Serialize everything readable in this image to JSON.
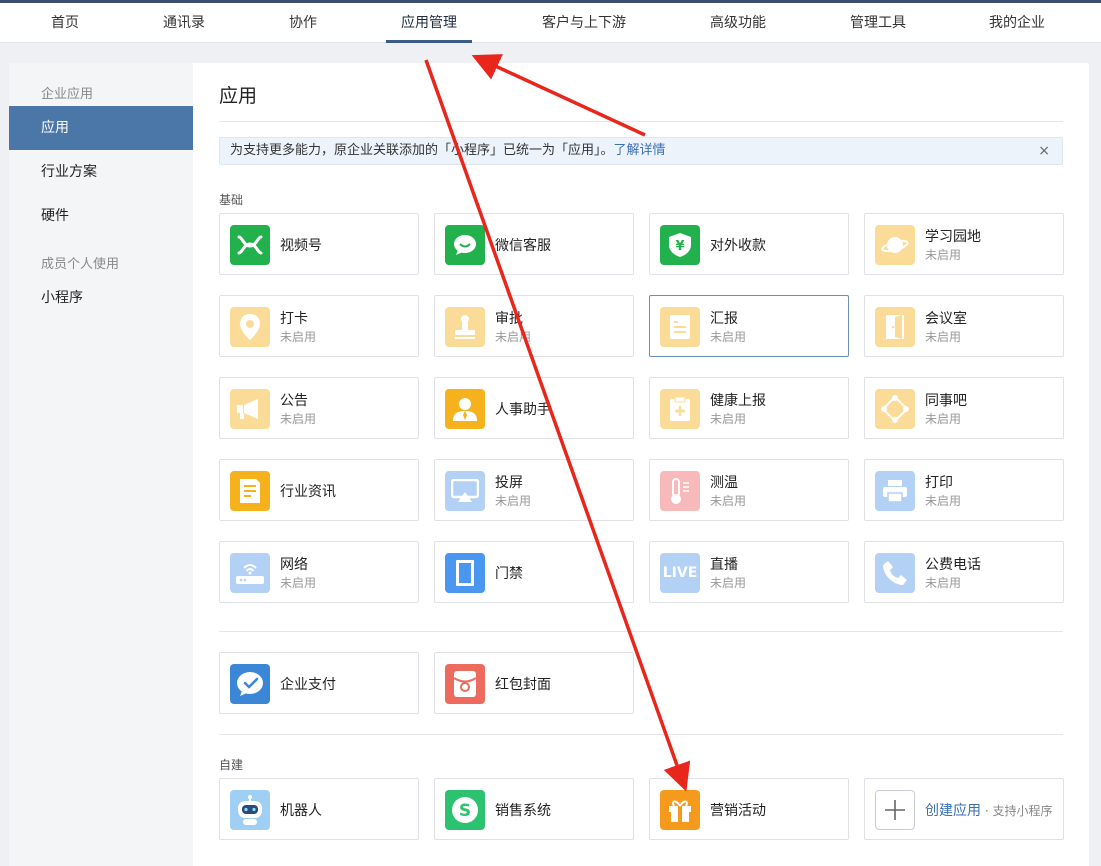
{
  "topnav": {
    "items": [
      {
        "label": "首页",
        "active": false
      },
      {
        "label": "通讯录",
        "active": false
      },
      {
        "label": "协作",
        "active": false
      },
      {
        "label": "应用管理",
        "active": true
      },
      {
        "label": "客户与上下游",
        "active": false
      },
      {
        "label": "高级功能",
        "active": false
      },
      {
        "label": "管理工具",
        "active": false
      },
      {
        "label": "我的企业",
        "active": false
      }
    ]
  },
  "sidebar": {
    "section1": "企业应用",
    "items1": [
      {
        "label": "应用",
        "active": true
      },
      {
        "label": "行业方案",
        "active": false
      },
      {
        "label": "硬件",
        "active": false
      }
    ],
    "section2": "成员个人使用",
    "items2": [
      {
        "label": "小程序",
        "active": false
      }
    ]
  },
  "main": {
    "title": "应用",
    "notice": {
      "text": "为支持更多能力，原企业关联添加的「小程序」已统一为「应用」。",
      "link": "了解详情",
      "close": "×"
    },
    "basic_label": "基础",
    "custom_label": "自建",
    "disabled_text": "未启用",
    "basic_apps": [
      {
        "name": "视频号",
        "enabled": true,
        "icon": "channels-icon",
        "color": "#22b14c"
      },
      {
        "name": "微信客服",
        "enabled": true,
        "icon": "chat-bubble-icon",
        "color": "#22b14c"
      },
      {
        "name": "对外收款",
        "enabled": true,
        "icon": "yuan-shield-icon",
        "color": "#22b14c"
      },
      {
        "name": "学习园地",
        "enabled": false,
        "icon": "planet-icon",
        "color": "#fbdb98"
      },
      {
        "name": "打卡",
        "enabled": false,
        "icon": "location-pin-icon",
        "color": "#fbdb98"
      },
      {
        "name": "审批",
        "enabled": false,
        "icon": "stamp-icon",
        "color": "#fbdb98"
      },
      {
        "name": "汇报",
        "enabled": false,
        "icon": "report-icon",
        "color": "#fbdb98"
      },
      {
        "name": "会议室",
        "enabled": false,
        "icon": "door-icon",
        "color": "#fbdb98"
      },
      {
        "name": "公告",
        "enabled": false,
        "icon": "megaphone-icon",
        "color": "#fbdb98"
      },
      {
        "name": "人事助手",
        "enabled": true,
        "icon": "person-icon",
        "color": "#f5b21d"
      },
      {
        "name": "健康上报",
        "enabled": false,
        "icon": "clipboard-plus-icon",
        "color": "#fbdb98"
      },
      {
        "name": "同事吧",
        "enabled": false,
        "icon": "network-icon",
        "color": "#fbdb98"
      },
      {
        "name": "行业资讯",
        "enabled": true,
        "icon": "news-icon",
        "color": "#f5b21d"
      },
      {
        "name": "投屏",
        "enabled": false,
        "icon": "screen-cast-icon",
        "color": "#b3d0f5"
      },
      {
        "name": "测温",
        "enabled": false,
        "icon": "thermometer-icon",
        "color": "#f7b9b9"
      },
      {
        "name": "打印",
        "enabled": false,
        "icon": "printer-icon",
        "color": "#b3d0f5"
      },
      {
        "name": "网络",
        "enabled": false,
        "icon": "router-icon",
        "color": "#b3d0f5"
      },
      {
        "name": "门禁",
        "enabled": true,
        "icon": "gate-icon",
        "color": "#4a96f0"
      },
      {
        "name": "直播",
        "enabled": false,
        "icon": "live-icon",
        "color": "#b3d0f5",
        "icon_text": "LIVE"
      },
      {
        "name": "公费电话",
        "enabled": false,
        "icon": "phone-icon",
        "color": "#b3d0f5"
      }
    ],
    "pay_apps": [
      {
        "name": "企业支付",
        "enabled": true,
        "icon": "pay-icon",
        "color": "#3c86d8"
      },
      {
        "name": "红包封面",
        "enabled": true,
        "icon": "red-packet-icon",
        "color": "#ec6b5e"
      }
    ],
    "custom_apps": [
      {
        "name": "机器人",
        "enabled": true,
        "icon": "robot-icon",
        "color": "#9fd0f4"
      },
      {
        "name": "销售系统",
        "enabled": true,
        "icon": "sales-icon",
        "color": "#2cc270"
      },
      {
        "name": "营销活动",
        "enabled": true,
        "icon": "gift-icon",
        "color": "#f59a1d"
      }
    ],
    "create": {
      "label": "创建应用",
      "sub": "· 支持小程序",
      "icon": "plus-icon"
    }
  }
}
